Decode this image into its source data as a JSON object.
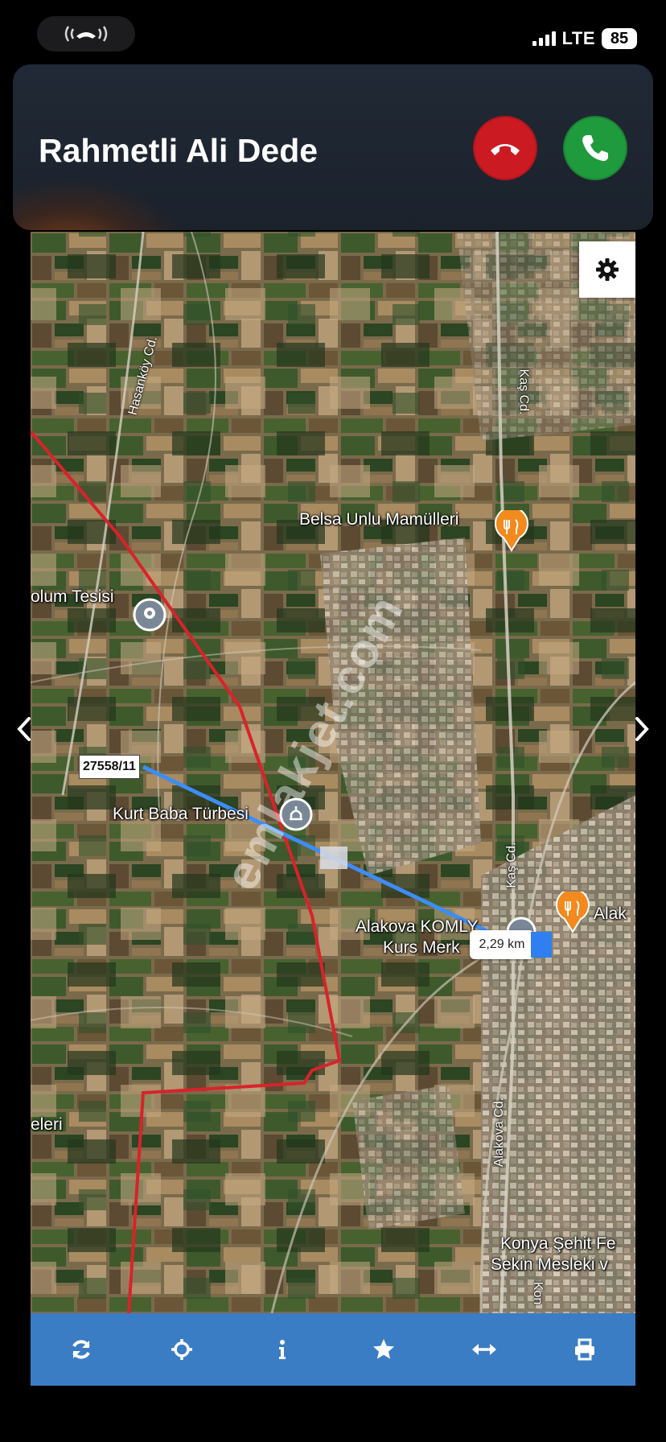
{
  "status_bar": {
    "call_indicator_icon": "phone-waves-icon",
    "network": "LTE",
    "battery": "85"
  },
  "incoming_call": {
    "caller_name": "Rahmetli Ali Dede",
    "decline_icon": "phone-down-icon",
    "accept_icon": "phone-icon",
    "decline_color": "#cc1a22",
    "accept_color": "#1f9a3c"
  },
  "map": {
    "settings_icon": "gear-icon",
    "prev_icon": "chevron-left-icon",
    "next_icon": "chevron-right-icon",
    "parcel_label": "27558/11",
    "distance_label": "2,29 km",
    "watermark": "emlakjet.com",
    "place_labels": {
      "belsa": "Belsa Unlu Mamülleri",
      "tesisi": "olum Tesisi",
      "turbesi": "Kurt Baba Türbesi",
      "alakova_line1": "Alakova KOMLY",
      "alakova_line2": "Kurs Merk",
      "alak": "Alak",
      "eleri": "eleri",
      "konya_line1": "Konya Şehit Fe",
      "konya_line2": "Sekin Mesleki v"
    },
    "road_labels": {
      "hasankoy": "Hasanköy Cd.",
      "kas_top": "Kaş Cd.",
      "kas_bottom": "Kaş Cd.",
      "alakova_cd": "Alakova Cd.",
      "kon": "Kon"
    },
    "colors": {
      "boundary": "#d8232a",
      "measure_line": "#3d8df5",
      "poi_orange": "#f28a1e"
    }
  },
  "toolbar": {
    "items": [
      {
        "icon": "refresh-icon"
      },
      {
        "icon": "locate-icon"
      },
      {
        "icon": "info-icon"
      },
      {
        "icon": "star-icon"
      },
      {
        "icon": "measure-icon"
      },
      {
        "icon": "print-icon"
      }
    ],
    "background": "#3b7dc4"
  }
}
